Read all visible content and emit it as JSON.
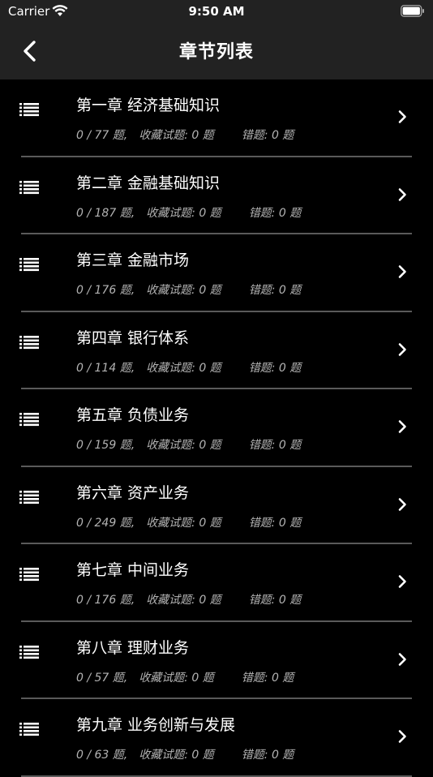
{
  "status_bar": {
    "carrier": "Carrier",
    "time": "9:50 AM"
  },
  "nav": {
    "title": "章节列表",
    "back_icon": "chevron-left-icon"
  },
  "chapters": [
    {
      "title": "第一章 经济基础知识",
      "progress": "0 / 77 题,",
      "favorites": "收藏试题: 0 题",
      "errors": "错题: 0 题"
    },
    {
      "title": "第二章 金融基础知识",
      "progress": "0 / 187 题,",
      "favorites": "收藏试题: 0 题",
      "errors": "错题: 0 题"
    },
    {
      "title": "第三章 金融市场",
      "progress": "0 / 176 题,",
      "favorites": "收藏试题: 0 题",
      "errors": "错题: 0 题"
    },
    {
      "title": "第四章 银行体系",
      "progress": "0 / 114 题,",
      "favorites": "收藏试题: 0 题",
      "errors": "错题: 0 题"
    },
    {
      "title": "第五章 负债业务",
      "progress": "0 / 159 题,",
      "favorites": "收藏试题: 0 题",
      "errors": "错题: 0 题"
    },
    {
      "title": "第六章 资产业务",
      "progress": "0 / 249 题,",
      "favorites": "收藏试题: 0 题",
      "errors": "错题: 0 题"
    },
    {
      "title": "第七章 中间业务",
      "progress": "0 / 176 题,",
      "favorites": "收藏试题: 0 题",
      "errors": "错题: 0 题"
    },
    {
      "title": "第八章 理财业务",
      "progress": "0 / 57 题,",
      "favorites": "收藏试题: 0 题",
      "errors": "错题: 0 题"
    },
    {
      "title": "第九章 业务创新与发展",
      "progress": "0 / 63 题,",
      "favorites": "收藏试题: 0 题",
      "errors": "错题: 0 题"
    }
  ],
  "colors": {
    "background": "#000000",
    "bar": "#222222",
    "divider": "#5a5a5a",
    "secondary_text": "#b3b3b3"
  }
}
